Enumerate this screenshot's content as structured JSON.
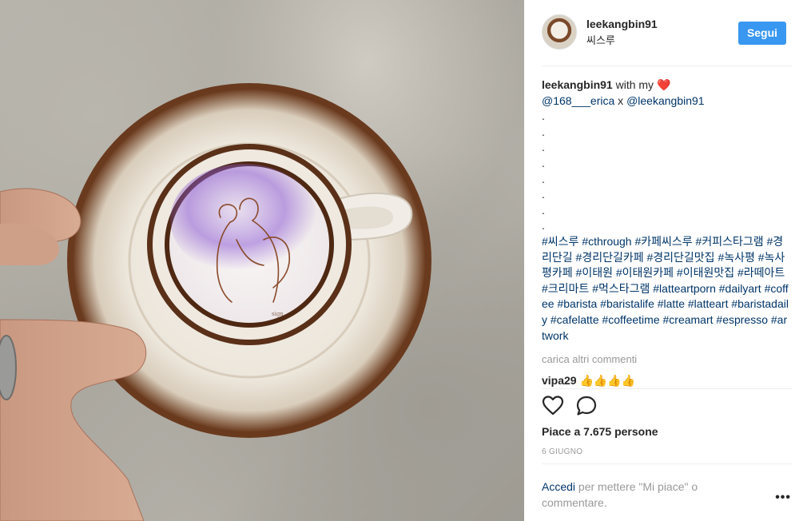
{
  "post": {
    "username": "leekangbin91",
    "location": "씨스루",
    "follow_label": "Segui",
    "caption_username": "leekangbin91",
    "caption_text": " with my ",
    "caption_emoji": "❤️",
    "mention_1": "@168___erica",
    "mention_sep": " x ",
    "mention_2": "@leekangbin91",
    "dot": ".",
    "hashtags": "#씨스루 #cthrough #카페씨스루 #커피스타그램 #경리단길 #경리단길카페 #경리단길맛집 #녹사평 #녹사평카페 #이태원 #이태원카페 #이태원맛집 #라떼아트 #크리마트 #먹스타그램 #latteartporn #dailyart #coffee #barista #baristalife #latte #latteart #baristadaily #cafelatte #coffeetime #creamart #espresso #artwork",
    "load_more": "carica altri commenti",
    "comment_user": "vipa29",
    "comment_text": "👍👍👍👍",
    "likes": "Piace a 7.675 persone",
    "date": "6 GIUGNO",
    "login_link": "Accedi",
    "login_text": " per mettere \"Mi piace\" o commentare.",
    "more_options": "•••"
  },
  "icons": {
    "like": "heart-icon",
    "comment": "speech-bubble-icon"
  },
  "colors": {
    "follow_button": "#3897f0",
    "link": "#003569",
    "muted": "#999999"
  }
}
